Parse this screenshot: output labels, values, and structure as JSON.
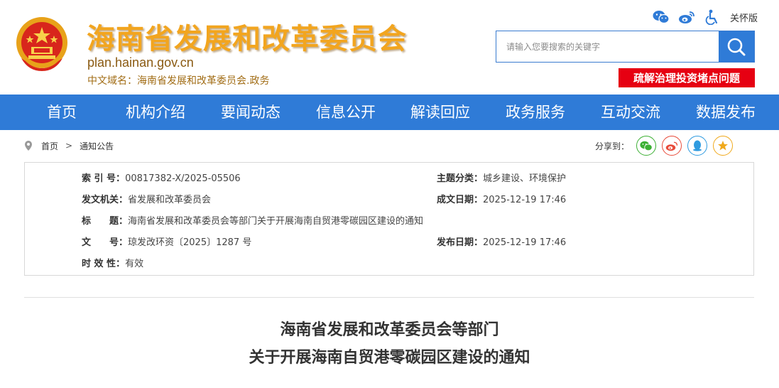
{
  "header": {
    "site_title": "海南省发展和改革委员会",
    "domain": "plan.hainan.gov.cn",
    "cn_domain": "中文域名：海南省发展和改革委员会.政务",
    "care_label": "关怀版",
    "search_placeholder": "请输入您要搜索的关键字",
    "hot_link": "疏解治理投资堵点问题"
  },
  "nav": {
    "items": [
      "首页",
      "机构介绍",
      "要闻动态",
      "信息公开",
      "解读回应",
      "政务服务",
      "互动交流",
      "数据发布"
    ]
  },
  "breadcrumb": {
    "home": "首页",
    "sep": ">",
    "current": "通知公告"
  },
  "share": {
    "label": "分享到："
  },
  "meta": {
    "index_key": "索 引 号：",
    "index_val": "00817382-X/2025-05506",
    "topic_key": "主题分类：",
    "topic_val": "城乡建设、环境保护",
    "issuer_key": "发文机关：",
    "issuer_val": "省发展和改革委员会",
    "created_key": "成文日期：",
    "created_val": "2025-12-19 17:46",
    "title_key": "标　　题：",
    "title_val": "海南省发展和改革委员会等部门关于开展海南自贸港零碳园区建设的通知",
    "docno_key": "文　　号：",
    "docno_val": "琼发改环资〔2025〕1287 号",
    "published_key": "发布日期：",
    "published_val": "2025-12-19 17:46",
    "validity_key": "时 效 性：",
    "validity_val": "有效"
  },
  "document": {
    "title_line1": "海南省发展和改革委员会等部门",
    "title_line2": "关于开展海南自贸港零碳园区建设的通知"
  },
  "colors": {
    "nav_blue": "#2f7bd7",
    "title_gold": "#f2a51f",
    "hot_red": "#e60012"
  }
}
